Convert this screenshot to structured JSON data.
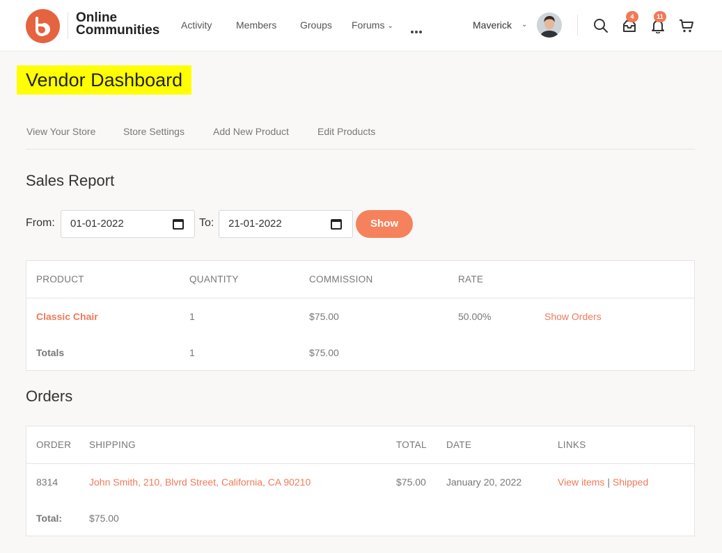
{
  "header": {
    "logo_line1": "Online",
    "logo_line2": "Communities",
    "nav": [
      "Activity",
      "Members",
      "Groups",
      "Forums"
    ],
    "user_name": "Maverick",
    "messages_badge": "4",
    "notifications_badge": "11",
    "accent_color": "#e5633f"
  },
  "page": {
    "title": "Vendor Dashboard",
    "subnav": [
      "View Your Store",
      "Store Settings",
      "Add New Product",
      "Edit Products"
    ]
  },
  "sales_report": {
    "title": "Sales Report",
    "from_label": "From:",
    "from_value": "01-01-2022",
    "to_label": "To:",
    "to_value": "21-01-2022",
    "show_button": "Show",
    "columns": [
      "PRODUCT",
      "QUANTITY",
      "COMMISSION",
      "RATE"
    ],
    "rows": [
      {
        "product": "Classic Chair",
        "quantity": "1",
        "commission": "$75.00",
        "rate": "50.00%",
        "action": "Show Orders"
      }
    ],
    "totals": {
      "label": "Totals",
      "quantity": "1",
      "commission": "$75.00"
    }
  },
  "orders": {
    "title": "Orders",
    "columns": [
      "ORDER",
      "SHIPPING",
      "TOTAL",
      "DATE",
      "LINKS"
    ],
    "rows": [
      {
        "order": "8314",
        "shipping": "John Smith, 210, Blvrd Street, California, CA 90210",
        "total": "$75.00",
        "date": "January 20, 2022",
        "link_view": "View items",
        "link_sep": "|",
        "link_shipped": "Shipped"
      }
    ],
    "total": {
      "label": "Total:",
      "value": "$75.00"
    }
  }
}
